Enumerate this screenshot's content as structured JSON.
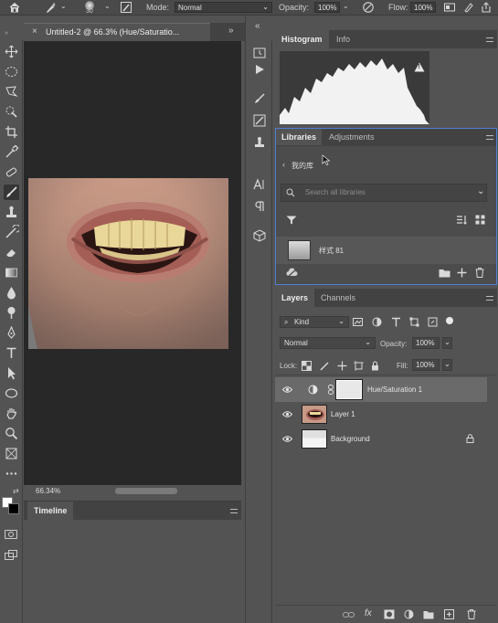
{
  "options_bar": {
    "brush_size": "30",
    "mode_label": "Mode:",
    "mode_value": "Normal",
    "opacity_label": "Opacity:",
    "opacity_value": "100%",
    "flow_label": "Flow:",
    "flow_value": "100%"
  },
  "document": {
    "tab_title": "Untitled-2 @ 66.3% (Hue/Saturatio...",
    "close_glyph": "×",
    "zoom": "66.34%"
  },
  "timeline": {
    "title": "Timeline"
  },
  "histogram_panel": {
    "tabs": [
      "Histogram",
      "Info"
    ],
    "warning_glyph": "!"
  },
  "libraries_panel": {
    "tabs": [
      "Libraries",
      "Adjustments"
    ],
    "breadcrumb": "我的库",
    "search_placeholder": "Search all libraries",
    "item_label": "样式 81"
  },
  "layers_panel": {
    "tabs": [
      "Layers",
      "Channels"
    ],
    "filter_kind": "Kind",
    "blend_mode": "Normal",
    "opacity_label": "Opacity:",
    "opacity_value": "100%",
    "lock_label": "Lock:",
    "fill_label": "Fill:",
    "fill_value": "100%",
    "layers": [
      {
        "name": "Hue/Saturation 1",
        "selected": true
      },
      {
        "name": "Layer 1",
        "selected": false
      },
      {
        "name": "Background",
        "selected": false,
        "locked": true
      }
    ],
    "footer_text": "fx"
  },
  "colors": {
    "accent": "#4f7fd2",
    "panel_bg": "#535353",
    "canvas_bg": "#282828"
  },
  "icons": {
    "toolbar": [
      "move-icon",
      "marquee-icon",
      "lasso-icon",
      "quick-select-icon",
      "crop-icon",
      "eyedropper-icon",
      "healing-icon",
      "brush-icon",
      "stamp-icon",
      "history-brush-icon",
      "eraser-icon",
      "gradient-icon",
      "blur-icon",
      "dodge-icon",
      "pen-icon",
      "type-icon",
      "path-select-icon",
      "ellipse-icon",
      "hand-icon",
      "zoom-icon",
      "artboard-icon",
      "more-tools-icon"
    ]
  }
}
